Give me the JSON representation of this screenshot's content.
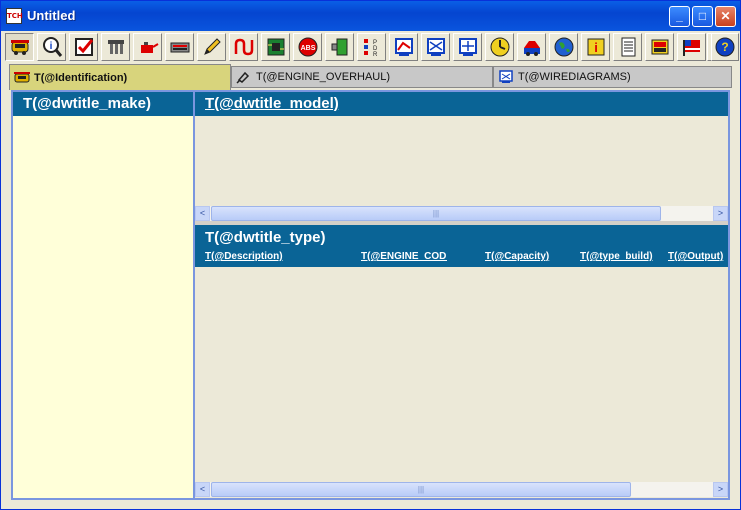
{
  "window": {
    "title": "Untitled",
    "app_icon_text": "TCH"
  },
  "toolbar": {
    "icons": [
      "car-icon",
      "search-info-icon",
      "checklist-icon",
      "belt-icon",
      "oil-can-icon",
      "battery-icon",
      "pencil-icon",
      "wire-icon",
      "circuit-board-icon",
      "abs-icon",
      "connector-icon",
      "pdr-icon",
      "diagram-icon",
      "wiring-diagram-icon",
      "wiring-diagram-2-icon",
      "clock-gauge-icon",
      "tyre-icon",
      "globe-icon",
      "info-icon",
      "document-icon",
      "book-icon",
      "flag-icon",
      "support-person-icon",
      "help-icon"
    ]
  },
  "tabs": [
    {
      "label": "T(@Identification)",
      "active": true,
      "icon": "car-icon"
    },
    {
      "label": "T(@ENGINE_OVERHAUL)",
      "active": false,
      "icon": "piston-icon"
    },
    {
      "label": "T(@WIREDIAGRAMS)",
      "active": false,
      "icon": "diagram-icon"
    }
  ],
  "make_pane": {
    "title": "T(@dwtitle_make)"
  },
  "model_pane": {
    "title": "T(@dwtitle_model)"
  },
  "type_pane": {
    "title": "T(@dwtitle_type)",
    "columns": [
      "T(@Description)",
      "T(@ENGINE_CODE)",
      "T(@Capacity)",
      "T(@type_build)",
      "T(@Output)"
    ]
  },
  "scrollbars": {
    "left_arrow": "<",
    "right_arrow": ">",
    "thumb_grip": "|||"
  },
  "colors": {
    "header_bg": "#0A6496",
    "make_pane_bg": "#FFFFD9",
    "active_tab_bg": "#D8D47C",
    "title_bar": "#0545D0"
  }
}
